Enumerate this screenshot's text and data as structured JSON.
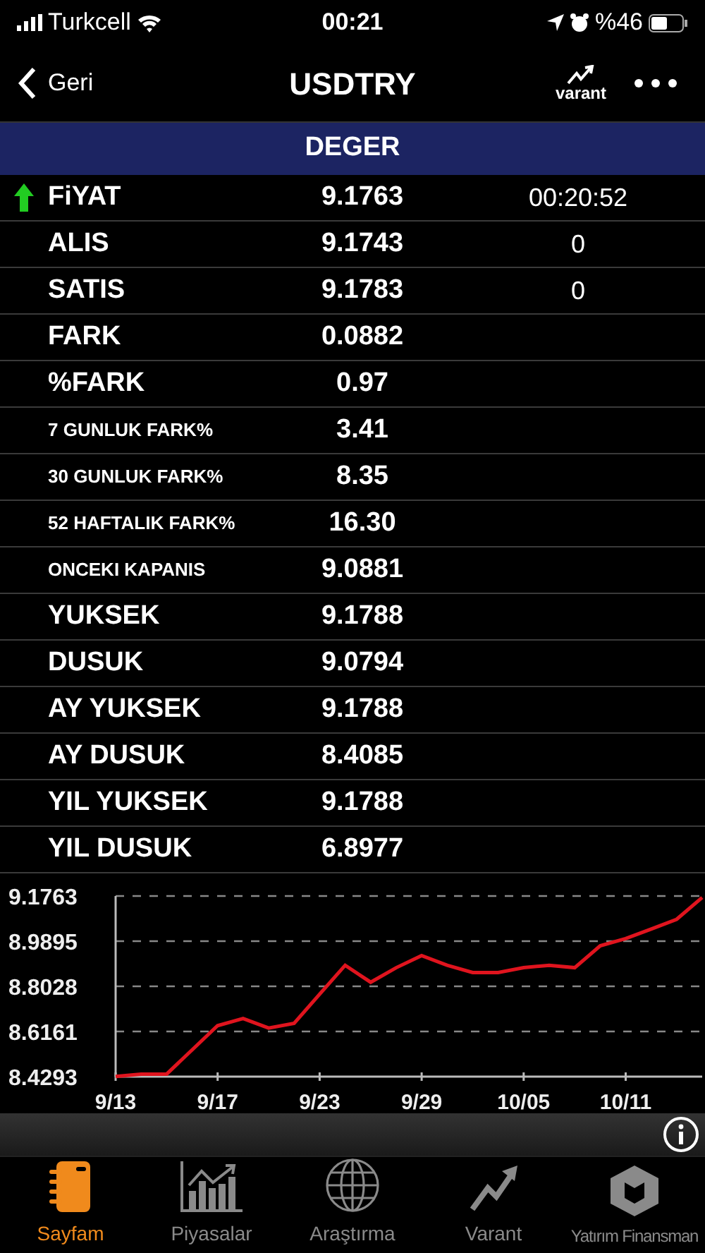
{
  "status_bar": {
    "carrier": "Turkcell",
    "time": "00:21",
    "battery": "%46"
  },
  "nav": {
    "back": "Geri",
    "title": "USDTRY",
    "varant_label": "varant"
  },
  "section_header": "DEGER",
  "rows": [
    {
      "label": "FiYAT",
      "value": "9.1763",
      "extra": "00:20:52",
      "kind": "normal",
      "rising": true
    },
    {
      "label": "ALIS",
      "value": "9.1743",
      "extra": "0",
      "kind": "normal"
    },
    {
      "label": "SATIS",
      "value": "9.1783",
      "extra": "0",
      "kind": "normal"
    },
    {
      "label": "FARK",
      "value": "0.0882",
      "kind": "normal"
    },
    {
      "label": "%FARK",
      "value": "0.97",
      "kind": "normal"
    },
    {
      "label": "7 GUNLUK FARK%",
      "value": "3.41",
      "kind": "small"
    },
    {
      "label": "30 GUNLUK FARK%",
      "value": "8.35",
      "kind": "small"
    },
    {
      "label": "52 HAFTALIK FARK%",
      "value": "16.30",
      "kind": "small"
    },
    {
      "label": "ONCEKI KAPANIS",
      "value": "9.0881",
      "kind": "small"
    },
    {
      "label": "YUKSEK",
      "value": "9.1788",
      "kind": "normal"
    },
    {
      "label": "DUSUK",
      "value": "9.0794",
      "kind": "normal"
    },
    {
      "label": "AY YUKSEK",
      "value": "9.1788",
      "kind": "normal"
    },
    {
      "label": "AY DUSUK",
      "value": "8.4085",
      "kind": "normal"
    },
    {
      "label": "YIL YUKSEK",
      "value": "9.1788",
      "kind": "normal"
    },
    {
      "label": "YIL DUSUK",
      "value": "6.8977",
      "kind": "normal"
    }
  ],
  "chart": {
    "chart_data": {
      "type": "line",
      "categories": [
        "9/13",
        null,
        null,
        null,
        "9/17",
        null,
        null,
        null,
        "9/23",
        null,
        null,
        null,
        "9/29",
        null,
        null,
        null,
        "10/05",
        null,
        null,
        null,
        "10/11",
        null,
        null,
        null
      ],
      "series": [
        {
          "color": "#e0141e",
          "values": [
            8.43,
            8.44,
            8.44,
            8.54,
            8.64,
            8.67,
            8.63,
            8.65,
            8.77,
            8.89,
            8.82,
            8.88,
            8.93,
            8.89,
            8.86,
            8.86,
            8.88,
            8.89,
            8.88,
            8.97,
            9.0,
            9.04,
            9.08,
            9.17
          ]
        }
      ],
      "ylim": [
        8.4293,
        9.1763
      ],
      "grid": true,
      "yticks": [
        {
          "value": 8.4293,
          "label": "8.4293"
        },
        {
          "value": 8.6161,
          "label": "8.6161"
        },
        {
          "value": 8.8028,
          "label": "8.8028"
        },
        {
          "value": 8.9895,
          "label": "8.9895"
        },
        {
          "value": 9.1763,
          "label": "9.1763"
        }
      ]
    }
  },
  "tabs": [
    {
      "label": "Sayfam",
      "selected": true,
      "kind": "notebook"
    },
    {
      "label": "Piyasalar",
      "selected": false,
      "kind": "barchart"
    },
    {
      "label": "Araştırma",
      "selected": false,
      "kind": "globe"
    },
    {
      "label": "Varant",
      "selected": false,
      "kind": "arrow"
    },
    {
      "label": "Yatırım Finansman",
      "selected": false,
      "kind": "logo"
    }
  ]
}
